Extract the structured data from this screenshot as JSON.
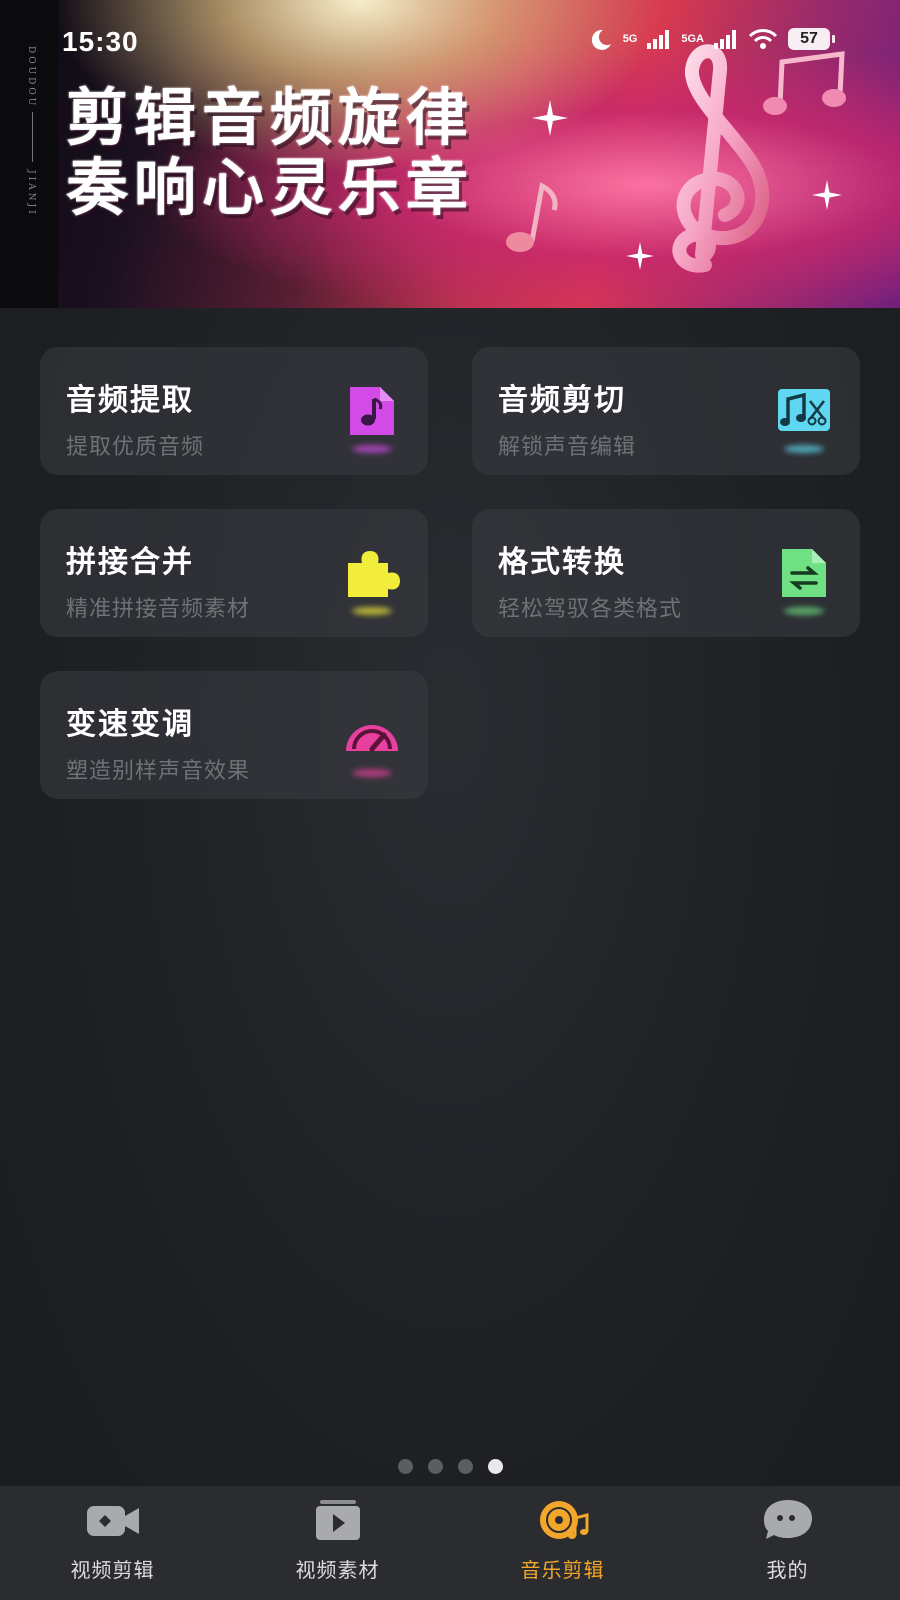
{
  "status_bar": {
    "time": "15:30",
    "signal_1": "5G",
    "signal_2": "5GA",
    "battery": "57"
  },
  "banner": {
    "title_line1": "剪辑音频旋律",
    "title_line2": "奏响心灵乐章",
    "side_text_top": "DOUDOU",
    "side_text_bottom": "JIANJI"
  },
  "tools": [
    {
      "title": "音频提取",
      "subtitle": "提取优质音频",
      "icon": "music-file-icon",
      "color": "#d24be6"
    },
    {
      "title": "音频剪切",
      "subtitle": "解锁声音编辑",
      "icon": "music-scissors-icon",
      "color": "#5fd7f0"
    },
    {
      "title": "拼接合并",
      "subtitle": "精准拼接音频素材",
      "icon": "puzzle-piece-icon",
      "color": "#f2ec3a"
    },
    {
      "title": "格式转换",
      "subtitle": "轻松驾驭各类格式",
      "icon": "file-convert-icon",
      "color": "#6fe083"
    },
    {
      "title": "变速变调",
      "subtitle": "塑造别样声音效果",
      "icon": "speedometer-icon",
      "color": "#e8409f"
    }
  ],
  "pager": {
    "count": 4,
    "active_index": 3
  },
  "tabs": [
    {
      "label": "视频剪辑",
      "icon": "video-camera-icon"
    },
    {
      "label": "视频素材",
      "icon": "video-play-icon"
    },
    {
      "label": "音乐剪辑",
      "icon": "music-disc-icon",
      "active": true
    },
    {
      "label": "我的",
      "icon": "chat-face-icon"
    }
  ],
  "colors": {
    "accent": "#f3a72a",
    "card_bg": "#3a3c42",
    "tabbar_bg": "#2b2c30"
  }
}
